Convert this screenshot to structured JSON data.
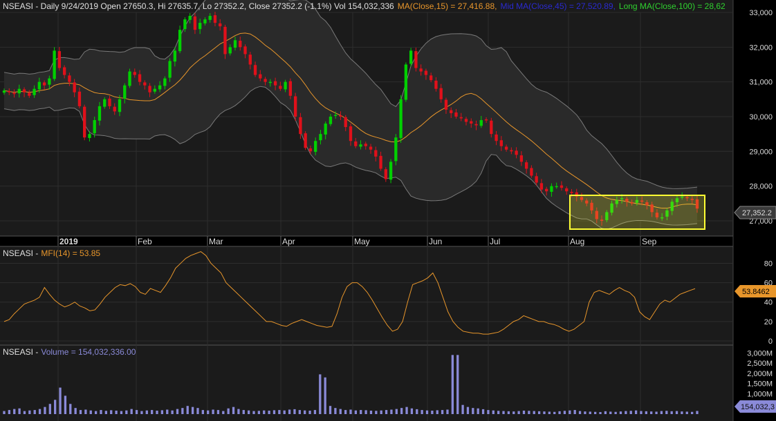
{
  "colors": {
    "background": "#000000",
    "panel": "#1b1b1b",
    "grid": "#2e2e2e",
    "up_candle": "#00d000",
    "down_candle": "#e0101a",
    "band": "#7a7a7a",
    "ma": "#e8962b",
    "mfi": "#e8962b",
    "volume": "#8a8ad8",
    "highlight": "#ffff33",
    "title_text": "#e0e0e0",
    "ma_label": "#e8962b",
    "mid_label": "#2a2ad0",
    "long_label": "#2fd02f",
    "mfi_label": "#e8962b",
    "volume_label": "#8a8ad8"
  },
  "price_panel": {
    "title": {
      "prefix": "NSEASI - Daily 9/24/2019 Open 27650.3, Hi 27635.7, Lo 27352.2, Close 27352.2 (-1.1%) Vol 154,032,336",
      "ma": "MA(Close,15) = 27,416.88,",
      "mid": "Mid MA(Close,45) = 27,520.89,",
      "long": "Long MA(Close,100) = 28,62"
    },
    "last_price_label": "27,352.2"
  },
  "mfi_panel": {
    "title_prefix": "NSEASI -",
    "title_value": "MFI(14) = 53.85",
    "last_value_label": "53.8462"
  },
  "volume_panel": {
    "title_prefix": "NSEASI -",
    "title_value": "Volume = 154,032,336.00",
    "last_value_label": "154,032,3"
  },
  "chart_data": [
    {
      "type": "candlestick",
      "title": "NSEASI - Daily 9/24/2019",
      "x_labels": [
        "2019",
        "Feb",
        "Mar",
        "Apr",
        "May",
        "Jun",
        "Jul",
        "Aug",
        "Sep"
      ],
      "y_ticks": [
        "33,000",
        "32,000",
        "31,000",
        "30,000",
        "29,000",
        "28,000",
        "27,000"
      ],
      "ylim": [
        26900,
        33000
      ],
      "close_series": [
        30750,
        30700,
        30650,
        30800,
        30700,
        30600,
        30800,
        31000,
        30900,
        31100,
        31900,
        31400,
        31200,
        31000,
        30700,
        30300,
        29400,
        29500,
        29900,
        30300,
        30500,
        30300,
        30150,
        30500,
        30900,
        31300,
        31200,
        31000,
        30900,
        30700,
        30800,
        30900,
        31100,
        31600,
        31900,
        32500,
        32800,
        32900,
        32500,
        32700,
        32800,
        32900,
        32700,
        32600,
        31800,
        32000,
        32200,
        32000,
        31800,
        31500,
        31200,
        31100,
        31000,
        31000,
        30900,
        30800,
        31000,
        30600,
        30000,
        29500,
        29100,
        29000,
        29300,
        29500,
        29800,
        30000,
        30050,
        30000,
        29700,
        29300,
        29150,
        29200,
        29150,
        29050,
        28850,
        28500,
        28200,
        28700,
        29400,
        30500,
        31500,
        31900,
        31400,
        31300,
        31200,
        31050,
        30800,
        30500,
        30200,
        30100,
        30000,
        29950,
        29850,
        29800,
        29750,
        29900,
        29900,
        29500,
        29300,
        29150,
        29050,
        29000,
        28900,
        28700,
        28500,
        28300,
        28100,
        27900,
        27850,
        28000,
        28000,
        27950,
        27850,
        27800,
        27700,
        27600,
        27500,
        27300,
        27050,
        27000,
        27250,
        27500,
        27600,
        27650,
        27550,
        27500,
        27600,
        27550,
        27450,
        27250,
        27100,
        27100,
        27300,
        27550,
        27650,
        27700,
        27650,
        27600,
        27352
      ],
      "overlays": [
        "Bollinger Bands",
        "MA(Close,15)"
      ],
      "highlight_region": "Aug-Sep consolidation box"
    },
    {
      "type": "line",
      "title": "MFI(14)",
      "y_ticks": [
        "80",
        "60",
        "40",
        "20",
        "0"
      ],
      "ylim": [
        0,
        100
      ],
      "values": [
        20,
        22,
        28,
        33,
        38,
        40,
        42,
        45,
        55,
        48,
        42,
        38,
        35,
        37,
        40,
        36,
        34,
        31,
        32,
        38,
        45,
        50,
        55,
        58,
        57,
        59,
        56,
        50,
        48,
        54,
        52,
        50,
        57,
        65,
        75,
        80,
        85,
        88,
        90,
        92,
        88,
        80,
        75,
        70,
        60,
        55,
        50,
        45,
        40,
        35,
        30,
        25,
        20,
        20,
        18,
        16,
        15,
        18,
        20,
        22,
        20,
        18,
        16,
        15,
        14,
        15,
        28,
        45,
        56,
        60,
        60,
        56,
        50,
        42,
        33,
        24,
        16,
        10,
        12,
        20,
        40,
        58,
        60,
        62,
        65,
        70,
        60,
        45,
        30,
        20,
        14,
        10,
        9,
        8,
        8,
        7,
        7,
        8,
        9,
        12,
        16,
        20,
        22,
        26,
        24,
        22,
        20,
        20,
        18,
        17,
        15,
        12,
        10,
        12,
        16,
        20,
        40,
        50,
        52,
        50,
        48,
        52,
        55,
        52,
        50,
        45,
        30,
        25,
        22,
        30,
        38,
        42,
        40,
        44,
        48,
        50,
        52,
        53.85
      ],
      "series": [
        {
          "name": "MFI(14)"
        }
      ]
    },
    {
      "type": "bar",
      "title": "Volume",
      "y_ticks": [
        "3,000M",
        "2,500M",
        "2,000M",
        "1,500M",
        "1,000M",
        "500M"
      ],
      "ylim": [
        0,
        3250
      ],
      "values_millions": [
        150,
        200,
        250,
        280,
        150,
        180,
        200,
        250,
        350,
        500,
        700,
        1300,
        900,
        500,
        300,
        200,
        220,
        180,
        150,
        200,
        160,
        190,
        170,
        150,
        180,
        250,
        200,
        150,
        180,
        200,
        170,
        190,
        220,
        180,
        250,
        300,
        400,
        350,
        300,
        200,
        180,
        220,
        200,
        150,
        280,
        350,
        250,
        200,
        180,
        150,
        160,
        180,
        170,
        190,
        200,
        180,
        220,
        240,
        200,
        180,
        170,
        200,
        1950,
        1800,
        400,
        300,
        250,
        200,
        220,
        180,
        200,
        190,
        170,
        160,
        180,
        200,
        220,
        250,
        300,
        350,
        280,
        240,
        200,
        180,
        170,
        190,
        200,
        220,
        2900,
        2900,
        450,
        350,
        300,
        280,
        240,
        200,
        180,
        160,
        150,
        140,
        130,
        150,
        170,
        160,
        150,
        140,
        130,
        120,
        110,
        140,
        160,
        180,
        200,
        150,
        130,
        120,
        110,
        100,
        140,
        120,
        110,
        130,
        150,
        160,
        180,
        150,
        140,
        130,
        120,
        150,
        160,
        140,
        150,
        130,
        120,
        110,
        154
      ]
    }
  ]
}
